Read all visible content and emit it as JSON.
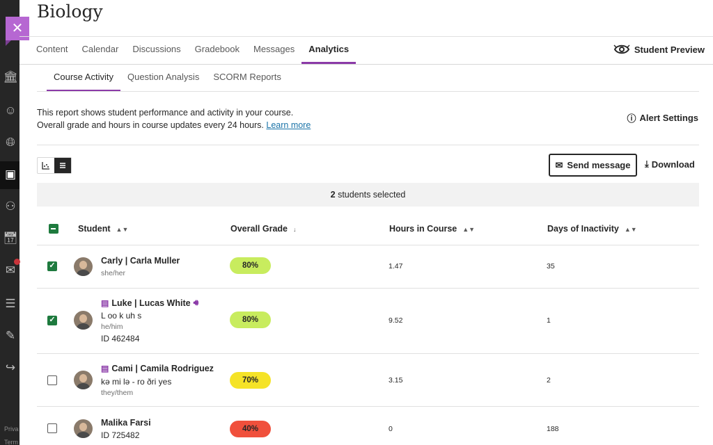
{
  "rail": {
    "privacy_label": "Priva",
    "terms_label": "Term"
  },
  "course": {
    "title": "Biology"
  },
  "nav": {
    "tabs": [
      "Content",
      "Calendar",
      "Discussions",
      "Gradebook",
      "Messages",
      "Analytics"
    ],
    "active": "Analytics",
    "student_preview": "Student Preview"
  },
  "subnav": {
    "tabs": [
      "Course Activity",
      "Question Analysis",
      "SCORM Reports"
    ],
    "active": "Course Activity"
  },
  "description": {
    "line1": "This report shows student performance and activity in your course.",
    "line2": "Overall grade and hours in course updates every 24 hours.",
    "learn_more": "Learn more"
  },
  "alert_settings": "Alert Settings",
  "actions": {
    "send_message": "Send message",
    "download": "Download"
  },
  "selection": {
    "count": "2",
    "text": "students selected"
  },
  "table": {
    "columns": [
      "Student",
      "Overall Grade",
      "Hours in Course",
      "Days of Inactivity"
    ],
    "rows": [
      {
        "name": "Carly | Carla Muller",
        "phonetic": "",
        "pronouns": "she/her",
        "id": "",
        "grade": "80%",
        "grade_color": "#c8ec5e",
        "hours": "1.47",
        "days": "35",
        "checked": true,
        "note_icon": false,
        "audio_icon": false
      },
      {
        "name": "Luke | Lucas White",
        "phonetic": "L oo k uh s",
        "pronouns": "he/him",
        "id": "ID 462484",
        "grade": "80%",
        "grade_color": "#c8ec5e",
        "hours": "9.52",
        "days": "1",
        "checked": true,
        "note_icon": true,
        "audio_icon": true
      },
      {
        "name": "Cami | Camila Rodriguez",
        "phonetic": "kə mi lə - ro ðri yes",
        "pronouns": "they/them",
        "id": "",
        "grade": "70%",
        "grade_color": "#f5e327",
        "hours": "3.15",
        "days": "2",
        "checked": false,
        "note_icon": true,
        "audio_icon": false
      },
      {
        "name": "Malika Farsi",
        "phonetic": "",
        "pronouns": "",
        "id": "ID 725482",
        "grade": "40%",
        "grade_color": "#f0503c",
        "hours": "0",
        "days": "188",
        "checked": false,
        "note_icon": false,
        "audio_icon": false
      }
    ]
  }
}
